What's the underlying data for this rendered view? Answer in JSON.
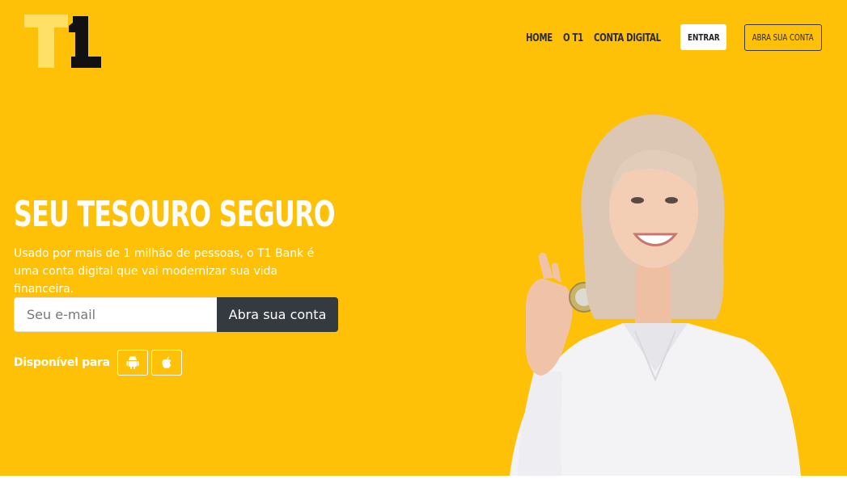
{
  "brand": {
    "logo_text": "T1",
    "logo_colors": [
      "#ffe066",
      "#111111"
    ]
  },
  "nav": {
    "items": [
      {
        "label": "HOME"
      },
      {
        "label": "O T1"
      },
      {
        "label": "CONTA DIGITAL"
      }
    ],
    "login_label": "ENTRAR",
    "open_account_label": "ABRA SUA CONTA"
  },
  "hero": {
    "title": "SEU TESOURO SEGURO",
    "subtitle": "Usado por mais de 1 milhão de pessoas, o T1 Bank é uma conta digital que vai modernizar sua vida financeira.",
    "email_placeholder": "Seu e-mail",
    "email_value": "",
    "cta_label": "Abra sua conta",
    "available_label": "Disponível para",
    "stores": [
      "android-icon",
      "apple-icon"
    ]
  },
  "colors": {
    "accent": "#ffc107",
    "dark": "#343a40",
    "white": "#ffffff"
  }
}
